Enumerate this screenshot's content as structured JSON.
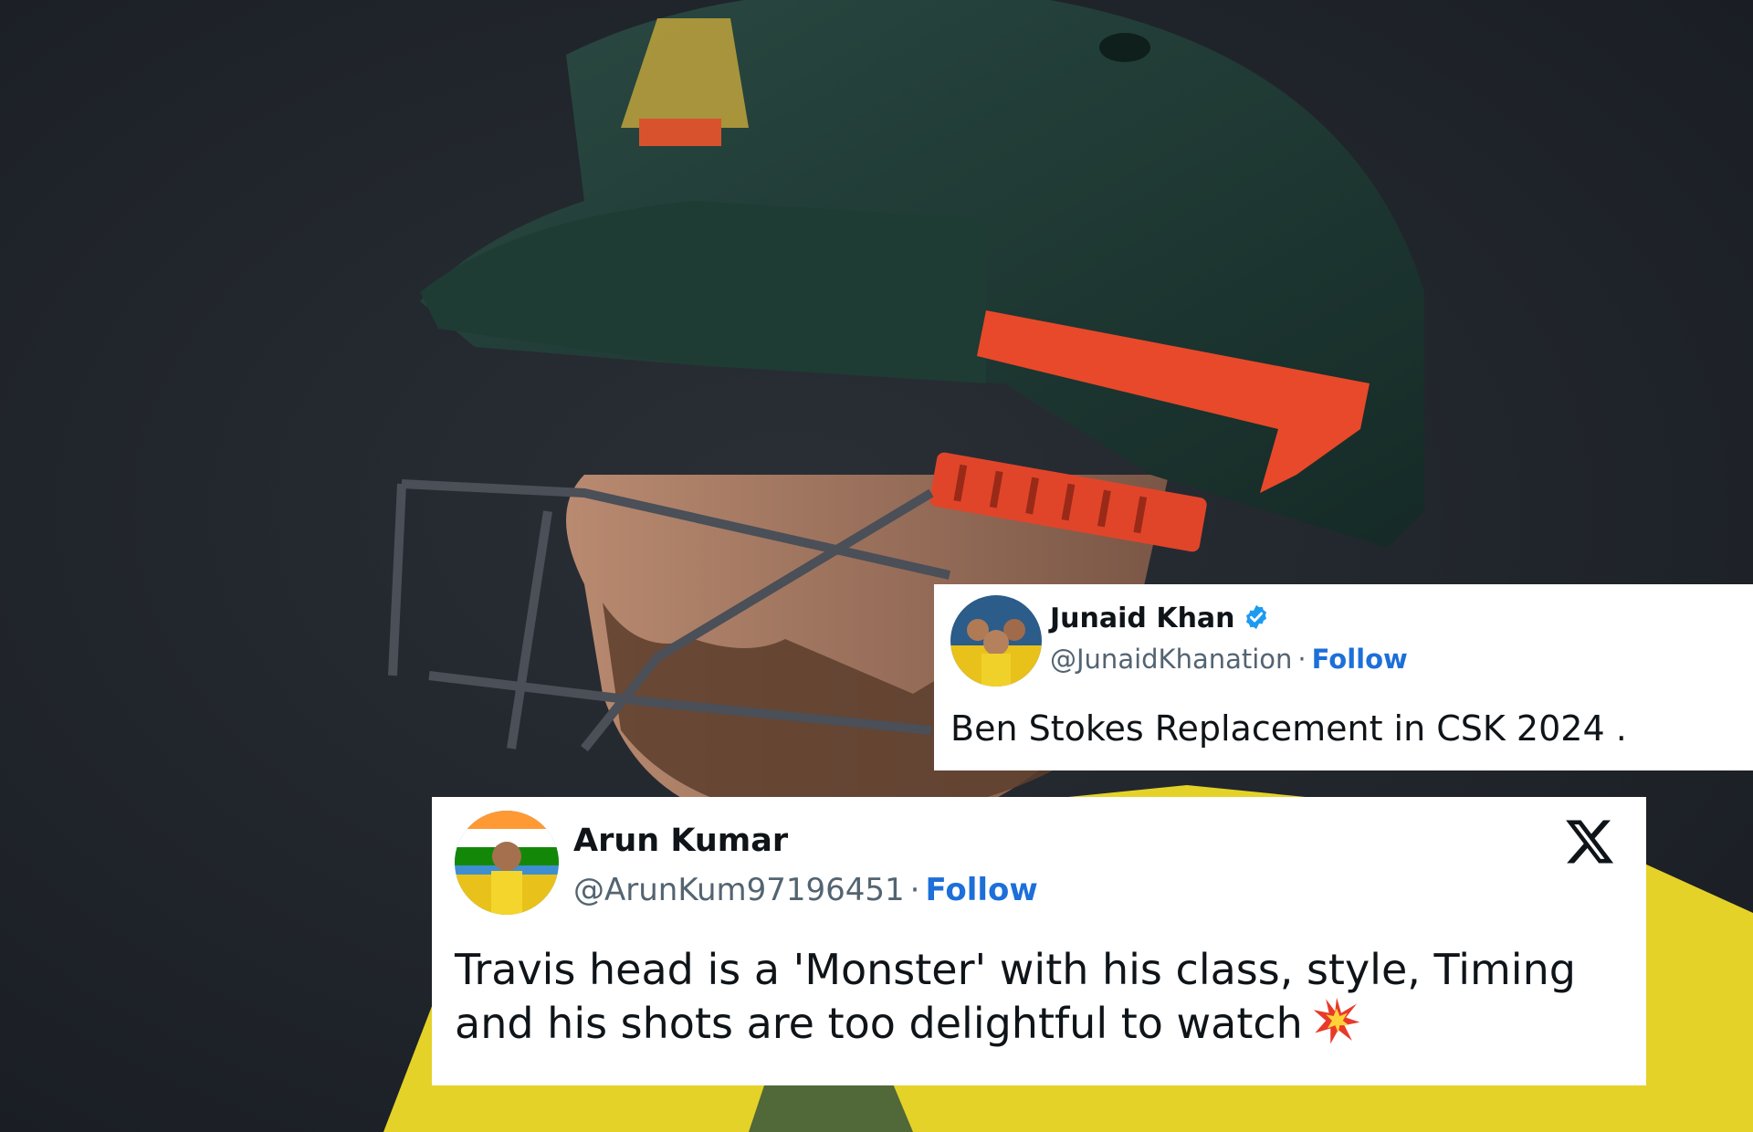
{
  "tweets": [
    {
      "display_name": "Junaid Khan",
      "verified": true,
      "handle": "@JunaidKhanation",
      "separator": "·",
      "follow_label": "Follow",
      "text": "Ben Stokes Replacement in CSK 2024 .",
      "avatar_icon": "profile-photo"
    },
    {
      "display_name": "Arun Kumar",
      "verified": false,
      "handle": "@ArunKum97196451",
      "separator": "·",
      "follow_label": "Follow",
      "text": "Travis head is a 'Monster' with his class, style, Timing and his shots are too delightful to watch",
      "emoji_icon": "collision-icon",
      "logo_icon": "x-logo-icon",
      "avatar_icon": "profile-photo"
    }
  ],
  "colors": {
    "follow": "#1d6fd9",
    "verified": "#1d9bf0",
    "helmet": "#1f3a34",
    "helmet_accent": "#e8492a",
    "jersey": "#e9d72b",
    "background": "#1d2229"
  }
}
